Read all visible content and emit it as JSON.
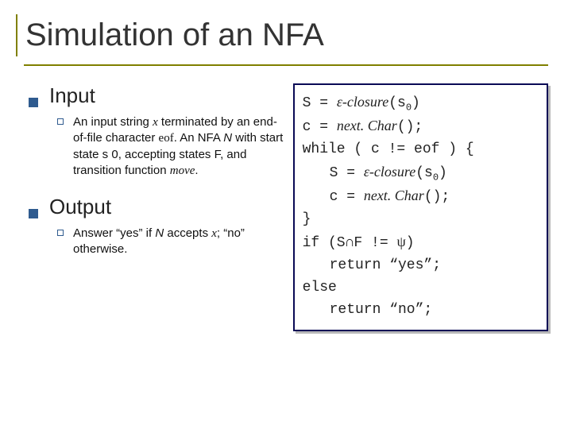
{
  "title": "Simulation of an NFA",
  "left": {
    "h1": "Input",
    "p1a": "An input string ",
    "p1_x": "x",
    "p1b": " terminated by an end-of-file character ",
    "p1_eof": "eof",
    "p1c": ". An NFA ",
    "p1_N": "N",
    "p1d": " with start state s 0, accepting states F, and transition function ",
    "p1_move": "move",
    "p1e": ".",
    "h2": "Output",
    "p2a": "Answer “yes” if ",
    "p2_N": "N",
    "p2b": " accepts ",
    "p2_x": "x",
    "p2c": "; “no” otherwise."
  },
  "code": {
    "l1a": "S = ",
    "l1b": "ε-closure",
    "l1c": "(s",
    "l1d": "0",
    "l1e": ")",
    "l2a": "c = ",
    "l2b": "next. Char",
    "l2c": "();",
    "l3": "while ( c != eof ) {",
    "l4a": "S = ",
    "l4b": "ε-closure",
    "l4c": "(s",
    "l4d": "0",
    "l4e": ")",
    "l5a": "c = ",
    "l5b": "next. Char",
    "l5c": "();",
    "l6": "}",
    "l7a": "if (S",
    "l7b": "∩",
    "l7c": "F != ",
    "l7d": "ψ",
    "l7e": ")",
    "l8": "return “yes”;",
    "l9": "else",
    "l10": "return “no”;"
  }
}
